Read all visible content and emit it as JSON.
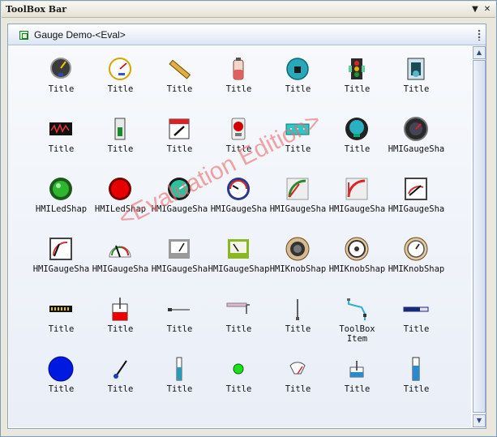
{
  "window": {
    "title": "ToolBox Bar",
    "menu_arrow": "▼",
    "close_glyph": "✕"
  },
  "panel": {
    "title": "Gauge Demo-<Eval>"
  },
  "watermark": "<Evaluation Edition>",
  "scrollbar": {
    "up": "▲",
    "down": "▼"
  },
  "items": [
    {
      "icon": "dial-gauge-icon",
      "label": "Title"
    },
    {
      "icon": "clock-gauge-icon",
      "label": "Title"
    },
    {
      "icon": "ruler-icon",
      "label": "Title"
    },
    {
      "icon": "battery-cylinder-icon",
      "label": "Title"
    },
    {
      "icon": "teal-dial-icon",
      "label": "Title"
    },
    {
      "icon": "stop-light-icon",
      "label": "Title"
    },
    {
      "icon": "thermometer-panel-icon",
      "label": "Title"
    },
    {
      "icon": "oscilloscope-icon",
      "label": "Title"
    },
    {
      "icon": "switch-icon",
      "label": "Title"
    },
    {
      "icon": "window-gauge-icon",
      "label": "Title"
    },
    {
      "icon": "red-led-box-icon",
      "label": "Title"
    },
    {
      "icon": "digital-display-icon",
      "label": "Title"
    },
    {
      "icon": "teal-round-gauge-icon",
      "label": "Title"
    },
    {
      "icon": "dark-round-gauge-icon",
      "label": "HMIGaugeSha"
    },
    {
      "icon": "green-led-icon",
      "label": "HMILedShap"
    },
    {
      "icon": "red-led-icon",
      "label": "HMILedShap"
    },
    {
      "icon": "green-dial-gauge-icon",
      "label": "HMIGaugeSha"
    },
    {
      "icon": "blue-dial-gauge-icon",
      "label": "HMIGaugeSha"
    },
    {
      "icon": "quarter-gauge-icon",
      "label": "HMIGaugeSha"
    },
    {
      "icon": "quarter-gauge-2-icon",
      "label": "HMIGaugeSha"
    },
    {
      "icon": "panel-meter-icon",
      "label": "HMIGaugeSha"
    },
    {
      "icon": "corner-meter-icon",
      "label": "HMIGaugeSha"
    },
    {
      "icon": "arc-meter-icon",
      "label": "HMIGaugeSha"
    },
    {
      "icon": "box-meter-icon",
      "label": "HMIGaugeSha"
    },
    {
      "icon": "green-box-meter-icon",
      "label": "HMIGaugeShap"
    },
    {
      "icon": "knob-icon",
      "label": "HMIKnobShap"
    },
    {
      "icon": "knob-2-icon",
      "label": "HMIKnobShap"
    },
    {
      "icon": "knob-3-icon",
      "label": "HMIKnobShap"
    },
    {
      "icon": "segmented-bar-icon",
      "label": "Title"
    },
    {
      "icon": "tank-icon",
      "label": "Title"
    },
    {
      "icon": "slider-line-icon",
      "label": "Title"
    },
    {
      "icon": "pipe-icon",
      "label": "Title"
    },
    {
      "icon": "vertical-line-icon",
      "label": "Title"
    },
    {
      "icon": "connector-icon",
      "label": "ToolBox\nItem"
    },
    {
      "icon": "progress-bar-icon",
      "label": "Title"
    },
    {
      "icon": "blue-circle-icon",
      "label": "Title"
    },
    {
      "icon": "needle-icon",
      "label": "Title"
    },
    {
      "icon": "vertical-bar-icon",
      "label": "Title"
    },
    {
      "icon": "green-dot-icon",
      "label": "Title"
    },
    {
      "icon": "fan-gauge-icon",
      "label": "Title"
    },
    {
      "icon": "level-box-icon",
      "label": "Title"
    },
    {
      "icon": "vertical-bar-2-icon",
      "label": "Title"
    }
  ]
}
